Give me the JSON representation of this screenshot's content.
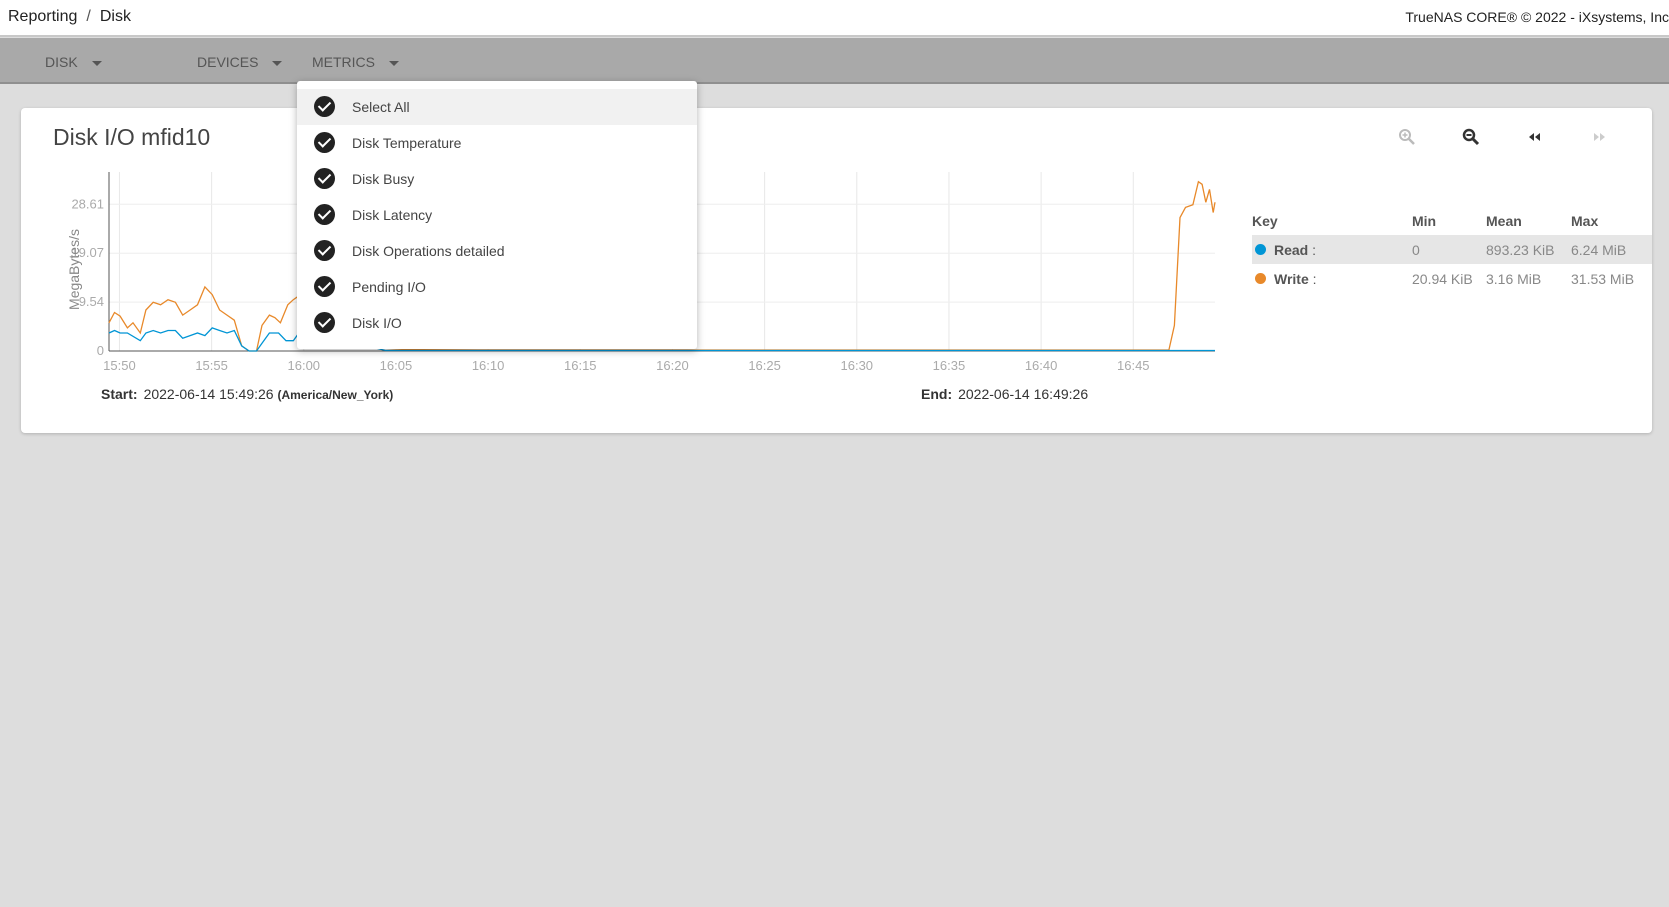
{
  "breadcrumb": {
    "parent": "Reporting",
    "separator": "/",
    "current": "Disk"
  },
  "copyright": "TrueNAS CORE® © 2022 - iXsystems, Inc",
  "toolbar": {
    "disk": "DISK",
    "devices": "DEVICES",
    "metrics": "METRICS"
  },
  "card": {
    "title": "Disk I/O mfid10"
  },
  "controls": [
    "zoom-in-icon",
    "zoom-out-icon",
    "rewind-icon",
    "fast-forward-icon"
  ],
  "range": {
    "start_label": "Start:",
    "start": "2022-06-14 15:49:26",
    "tz": "(America/New_York)",
    "end_label": "End:",
    "end": "2022-06-14 16:49:26"
  },
  "legend": {
    "headers": {
      "key": "Key",
      "min": "Min",
      "mean": "Mean",
      "max": "Max"
    },
    "rows": [
      {
        "name": "Read",
        "suffix": " :",
        "color": "#0095d5",
        "min": "0",
        "mean": "893.23 KiB",
        "max": "6.24 MiB"
      },
      {
        "name": "Write",
        "suffix": " :",
        "color": "#e8892a",
        "min": "20.94 KiB",
        "mean": "3.16 MiB",
        "max": "31.53 MiB"
      }
    ]
  },
  "metrics_menu": [
    "Select All",
    "Disk Temperature",
    "Disk Busy",
    "Disk Latency",
    "Disk Operations detailed",
    "Pending I/O",
    "Disk I/O"
  ],
  "chart_data": {
    "type": "line",
    "ylabel": "MegaBytes/s",
    "yticks": [
      0,
      9.54,
      19.07,
      28.61
    ],
    "ylim": [
      0,
      34.9
    ],
    "xticks": [
      "15:50",
      "15:55",
      "16:00",
      "16:05",
      "16:10",
      "16:15",
      "16:20",
      "16:25",
      "16:30",
      "16:35",
      "16:40",
      "16:45"
    ],
    "x_unit": "minutes since 15:49:26",
    "xlim": [
      0,
      60
    ],
    "series": [
      {
        "name": "Write",
        "color": "#e8892a",
        "points": [
          [
            0,
            5.5
          ],
          [
            0.3,
            7.5
          ],
          [
            0.6,
            6.8
          ],
          [
            1,
            4.5
          ],
          [
            1.3,
            5.5
          ],
          [
            1.7,
            3.5
          ],
          [
            2,
            8
          ],
          [
            2.4,
            9.5
          ],
          [
            2.8,
            9
          ],
          [
            3.2,
            10
          ],
          [
            3.6,
            9.5
          ],
          [
            4,
            7
          ],
          [
            4.4,
            8
          ],
          [
            4.8,
            9
          ],
          [
            5.2,
            12.5
          ],
          [
            5.6,
            11
          ],
          [
            6,
            8
          ],
          [
            6.4,
            7
          ],
          [
            6.8,
            6
          ],
          [
            7.2,
            1
          ],
          [
            7.6,
            0
          ],
          [
            8,
            0
          ],
          [
            8.3,
            5
          ],
          [
            8.7,
            7
          ],
          [
            9,
            6.5
          ],
          [
            9.3,
            5.5
          ],
          [
            9.7,
            9
          ],
          [
            10,
            10
          ],
          [
            10.4,
            11
          ],
          [
            10.8,
            10
          ],
          [
            11.2,
            10
          ],
          [
            11.6,
            13
          ],
          [
            12,
            12
          ],
          [
            12.4,
            9
          ],
          [
            12.8,
            10
          ],
          [
            13,
            7.5
          ],
          [
            13.3,
            9.5
          ],
          [
            14,
            4
          ],
          [
            15,
            0.5
          ],
          [
            16,
            0.3
          ],
          [
            20,
            0.2
          ],
          [
            30,
            0.2
          ],
          [
            40,
            0.2
          ],
          [
            50,
            0.2
          ],
          [
            57.5,
            0.2
          ],
          [
            57.8,
            5
          ],
          [
            58.1,
            26
          ],
          [
            58.4,
            28
          ],
          [
            58.8,
            28.5
          ],
          [
            59.1,
            33
          ],
          [
            59.3,
            32.5
          ],
          [
            59.5,
            29
          ],
          [
            59.7,
            31.5
          ],
          [
            59.9,
            27
          ],
          [
            60,
            29
          ]
        ]
      },
      {
        "name": "Read",
        "color": "#0095d5",
        "points": [
          [
            0,
            3.5
          ],
          [
            0.3,
            4
          ],
          [
            0.6,
            3.5
          ],
          [
            1,
            3.5
          ],
          [
            1.7,
            2
          ],
          [
            2,
            3.5
          ],
          [
            2.4,
            4
          ],
          [
            2.8,
            3.5
          ],
          [
            3.2,
            4
          ],
          [
            3.6,
            4
          ],
          [
            4,
            2.5
          ],
          [
            4.4,
            3
          ],
          [
            4.8,
            3.5
          ],
          [
            5.2,
            3
          ],
          [
            5.6,
            4.5
          ],
          [
            6,
            4
          ],
          [
            6.4,
            3.5
          ],
          [
            6.8,
            4
          ],
          [
            7.2,
            1
          ],
          [
            7.6,
            0
          ],
          [
            8,
            0
          ],
          [
            8.3,
            1.5
          ],
          [
            8.7,
            3.5
          ],
          [
            9.2,
            3.5
          ],
          [
            9.6,
            2
          ],
          [
            10,
            2
          ],
          [
            10.4,
            4
          ],
          [
            10.8,
            5
          ],
          [
            11.2,
            5.5
          ],
          [
            11.6,
            3
          ],
          [
            12.2,
            3
          ],
          [
            12.8,
            3.5
          ],
          [
            13.3,
            3.5
          ],
          [
            14,
            1
          ],
          [
            15,
            0.1
          ],
          [
            30,
            0.1
          ],
          [
            45,
            0.1
          ],
          [
            57.5,
            0.1
          ],
          [
            60,
            0.1
          ]
        ]
      }
    ]
  }
}
